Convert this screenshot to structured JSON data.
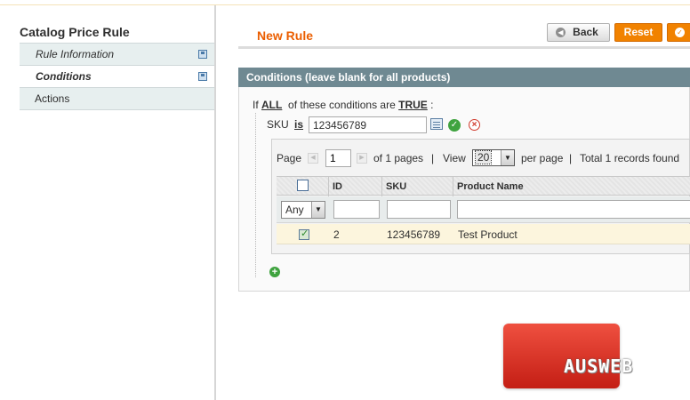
{
  "sidebar": {
    "title": "Catalog Price Rule",
    "items": [
      {
        "label": "Rule Information"
      },
      {
        "label": "Conditions"
      },
      {
        "label": "Actions"
      }
    ]
  },
  "header": {
    "title": "New Rule",
    "back_label": "Back",
    "reset_label": "Reset"
  },
  "conditions": {
    "fieldset_title": "Conditions (leave blank for all products)",
    "if_text": "If",
    "aggregator": "ALL",
    "middle_text": "of these conditions are",
    "value": "TRUE",
    "colon": ":",
    "sku_label": "SKU",
    "sku_operator": "is",
    "sku_value": "123456789"
  },
  "grid": {
    "page_label": "Page",
    "page_value": "1",
    "of_pages": "of 1 pages",
    "sep1": "|",
    "view_label": "View",
    "per_page": "20",
    "per_page_label": "per page",
    "sep2": "|",
    "total": "Total 1 records found",
    "columns": [
      "ID",
      "SKU",
      "Product Name"
    ],
    "filter_any": "Any",
    "rows": [
      {
        "id": "2",
        "sku": "123456789",
        "name": "Test Product"
      }
    ]
  },
  "logo": {
    "text": "AUSWEB"
  },
  "colors": {
    "accent": "#eb5e00",
    "button": "#f18200",
    "fieldset_header": "#6f8992",
    "row_highlight": "#fcf5dd"
  }
}
